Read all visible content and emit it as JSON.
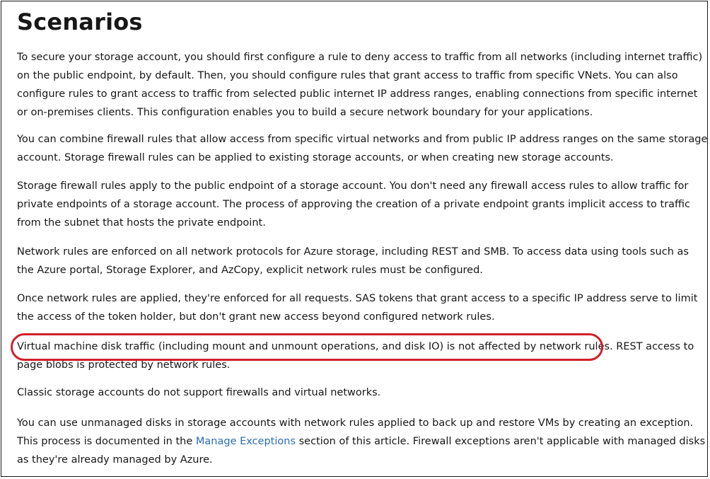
{
  "section": {
    "title": "Scenarios"
  },
  "paragraphs": [
    {
      "lines": [
        "To secure your storage account, you should first configure a rule to deny access to traffic from all networks (including internet traffic)",
        "on the public endpoint, by default. Then, you should configure rules that grant access to traffic from specific VNets. You can also",
        "configure rules to grant access to traffic from selected public internet IP address ranges, enabling connections from specific internet",
        "or on-premises clients. This configuration enables you to build a secure network boundary for your applications."
      ]
    },
    {
      "lines": [
        "You can combine firewall rules that allow access from specific virtual networks and from public IP address ranges on the same storage",
        "account. Storage firewall rules can be applied to existing storage accounts, or when creating new storage accounts."
      ]
    },
    {
      "lines": [
        "Storage firewall rules apply to the public endpoint of a storage account. You don't need any firewall access rules to allow traffic for",
        "private endpoints of a storage account. The process of approving the creation of a private endpoint grants implicit access to traffic",
        "from the subnet that hosts the private endpoint."
      ]
    },
    {
      "lines": [
        "Network rules are enforced on all network protocols for Azure storage, including REST and SMB. To access data using tools such as",
        "the Azure portal, Storage Explorer, and AzCopy, explicit network rules must be configured."
      ]
    },
    {
      "lines": [
        "Once network rules are applied, they're enforced for all requests. SAS tokens that grant access to a specific IP address serve to limit",
        "the access of the token holder, but don't grant new access beyond configured network rules."
      ]
    },
    {
      "lines": [
        "Virtual machine disk traffic (including mount and unmount operations, and disk IO) is not affected by network rules. REST access to",
        "page blobs is protected by network rules."
      ]
    },
    {
      "lines": [
        "Classic storage accounts do not support firewalls and virtual networks."
      ]
    },
    {
      "line1": "You can use unmanaged disks in storage accounts with network rules applied to back up and restore VMs by creating an exception.",
      "line2_before": "This process is documented in the ",
      "line2_link": "Manage Exceptions",
      "line2_after": " section of this article. Firewall exceptions aren't applicable with managed disks",
      "line3": "as they're already managed by Azure."
    }
  ],
  "highlight": {
    "color": "#d21f2b"
  },
  "colors": {
    "text": "#171717",
    "link": "#2a6ebb"
  }
}
